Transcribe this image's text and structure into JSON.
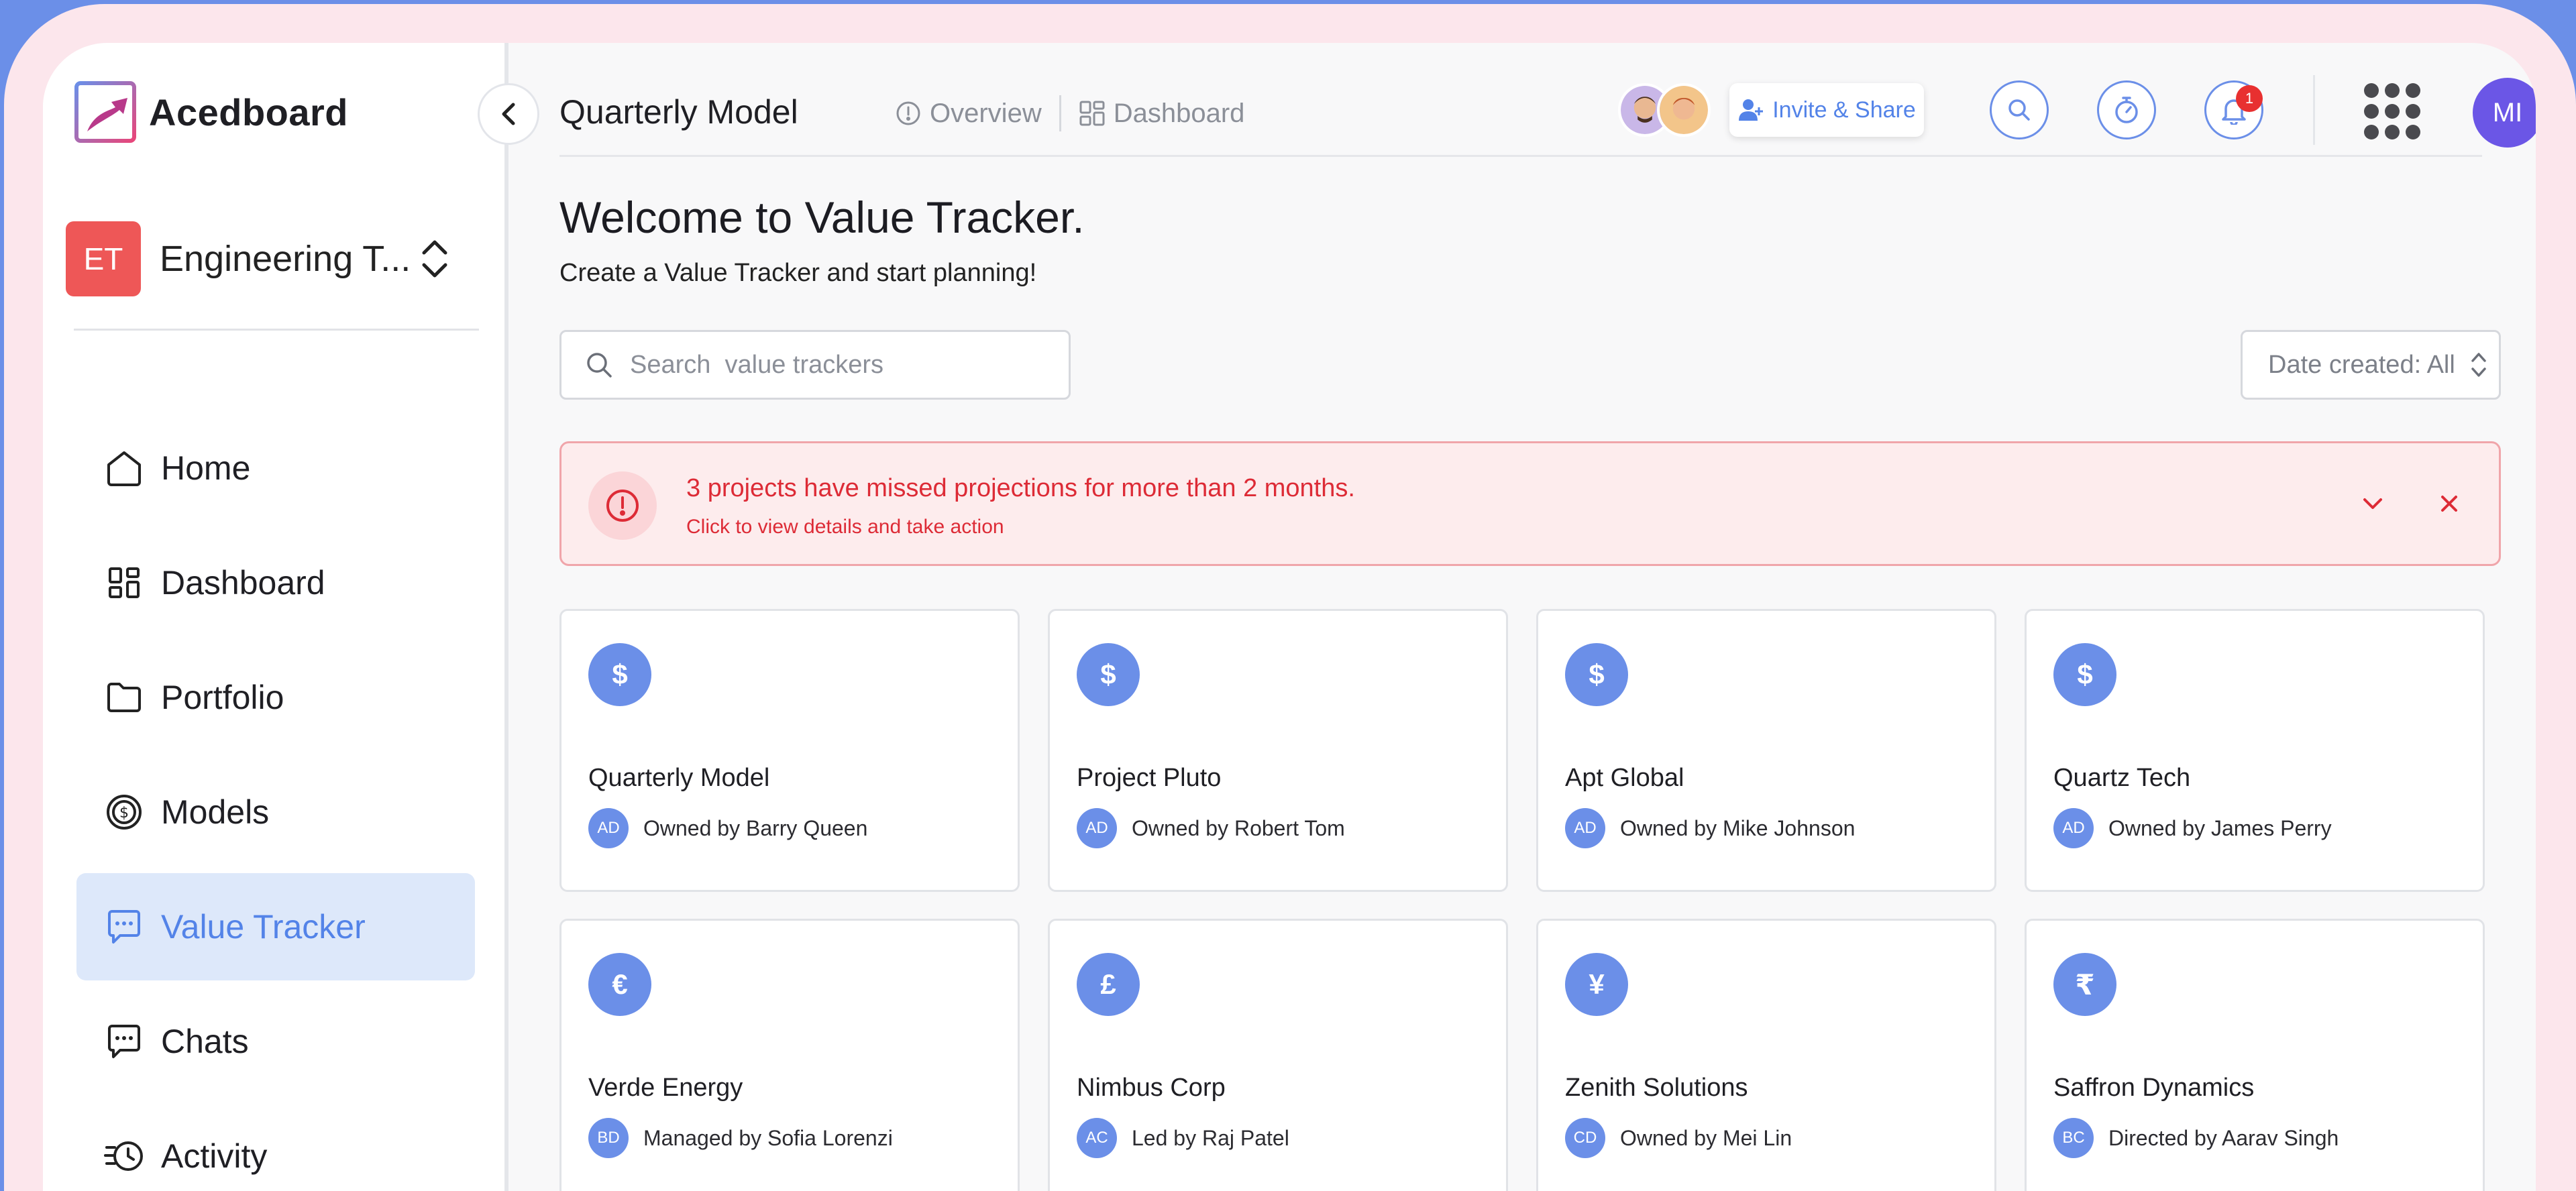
{
  "app": {
    "name": "Acedboard"
  },
  "workspace": {
    "initials": "ET",
    "name": "Engineering T..."
  },
  "sidebar": {
    "items": [
      {
        "label": "Home",
        "icon": "home-icon"
      },
      {
        "label": "Dashboard",
        "icon": "grid-icon"
      },
      {
        "label": "Portfolio",
        "icon": "folder-icon"
      },
      {
        "label": "Models",
        "icon": "dollar-coin-icon"
      },
      {
        "label": "Value Tracker",
        "icon": "chat-dots-icon",
        "active": true
      },
      {
        "label": "Chats",
        "icon": "chat-icon"
      },
      {
        "label": "Activity",
        "icon": "history-icon"
      }
    ]
  },
  "header": {
    "title": "Quarterly Model",
    "tabs": [
      {
        "label": "Overview",
        "icon": "info-icon"
      },
      {
        "label": "Dashboard",
        "icon": "grid-icon"
      }
    ],
    "invite_label": "Invite & Share",
    "notification_count": "1",
    "user_initials": "MI"
  },
  "main": {
    "welcome": "Welcome to Value Tracker.",
    "subtitle": "Create a Value Tracker and start planning!",
    "search_placeholder": "Search  value trackers",
    "date_filter": "Date created: All",
    "alert": {
      "title": "3 projects have missed projections for more than 2 months.",
      "subtitle": "Click to view details and take action"
    },
    "cards": [
      {
        "symbol": "$",
        "title": "Quarterly Model",
        "owner_initials": "AD",
        "owner_text": "Owned by Barry Queen"
      },
      {
        "symbol": "$",
        "title": "Project Pluto",
        "owner_initials": "AD",
        "owner_text": "Owned by Robert Tom"
      },
      {
        "symbol": "$",
        "title": "Apt Global",
        "owner_initials": "AD",
        "owner_text": "Owned by Mike Johnson"
      },
      {
        "symbol": "$",
        "title": "Quartz Tech",
        "owner_initials": "AD",
        "owner_text": "Owned by James Perry"
      },
      {
        "symbol": "€",
        "title": "Verde Energy",
        "owner_initials": "BD",
        "owner_text": "Managed by Sofia Lorenzi"
      },
      {
        "symbol": "£",
        "title": "Nimbus Corp",
        "owner_initials": "AC",
        "owner_text": "Led by Raj Patel"
      },
      {
        "symbol": "¥",
        "title": "Zenith Solutions",
        "owner_initials": "CD",
        "owner_text": "Owned by Mei Lin"
      },
      {
        "symbol": "₹",
        "title": "Saffron Dynamics",
        "owner_initials": "BC",
        "owner_text": "Directed by Aarav Singh"
      }
    ]
  },
  "colors": {
    "accent": "#6b8fe8",
    "active_bg": "#dde8fa",
    "alert_red": "#dd2b36",
    "workspace_red": "#ee5757",
    "user_purple": "#6b56e6"
  }
}
